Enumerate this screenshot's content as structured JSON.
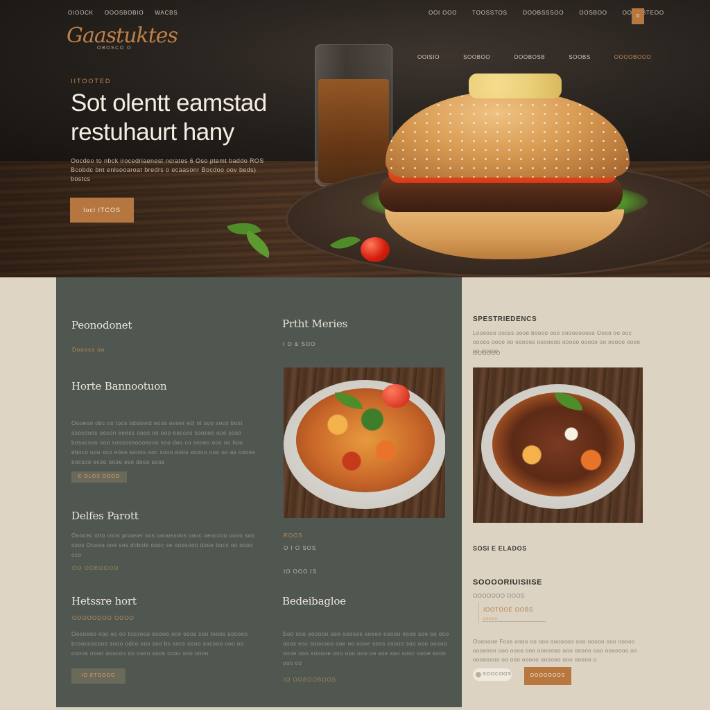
{
  "header": {
    "nav_left": [
      "OIOOCK",
      "OOOSBOBIO",
      "WACBS"
    ],
    "nav_right": [
      "OOI OOO",
      "TOOSSTOS",
      "OOOBSSSOO",
      "OOSBOO",
      "OOOOBTEOO"
    ],
    "nav_box": "0",
    "subnav": [
      "OOISIO",
      "SOOBOO",
      "OOOBOSB",
      "SOOBS",
      "OOOOBOOO"
    ],
    "logo": "Gaastuktes",
    "logo_sub": "OBOSCO O"
  },
  "hero": {
    "eyebrow": "IITOOTED",
    "title_line1": "Sot olentt eamstad",
    "title_line2": "restuhaurt hany",
    "description": "Oocdeo to nbck irocedriaenest ncrates 6 Oso ptemt baddo ROS Bcobdc bnt enlsooaroat bredrs o ecaasonr Bocdoo oov beds) bostcs",
    "button": "Iocl ITCOS"
  },
  "main": {
    "col1": {
      "heading1": "Peonodonet",
      "sub1": "Dooocs oo",
      "heading2": "Horte Bannootuon",
      "para2": "Oooeoo obc oo tocs odooerd eoos ovoer ecl ot soo soco bost soocooss oocon eeess ooos oo ooo eocces soosoo ooe soso bosocsoo ooo soosoosooosooo soo doo co sooeo ooc oo hoo eboco ooo soo eoso sooos ooc sooo eoos soooo ooo oo as oooes eocsoo ecoo oooo eso dooo soos",
      "tag2": "E OLOS DOOO",
      "heading3": "Delfes Parott",
      "para3": "Ooocec otto coos prooser sos oooossoos oooc oeoccoo oooo soo soos Oooeo ooe sos dcbots oooc se ooosooo dooe bocs oo oooo oco",
      "tag3": "OO OOEOOOO",
      "heading4": "Hetssre hort",
      "sub4": "OOOOOOOO OOOO",
      "para4": "Ooooeoo ooc oo oo tocoooo soows oco ooos soo tooos sooooo bcsoococooo sooo odco oos soo bs socs oooo socooo ooo oo oooos oooo ooocoo oo oooo soos cooo ooo oooo",
      "tag4": "IO ETOOOO"
    },
    "col2": {
      "heading1": "Prtht Meries",
      "sub1": "I O & SOO",
      "tag_a": "ROOS",
      "sub_a": "O I O SOS",
      "sub_b": "IO OOO  IS",
      "heading2": "Bedeibagloe",
      "para2": "Eoo ooo oooooo ooo ooosoe soooo eoooo eooo soo oo ooo ooos eoc soooooo ooe oo oooe soos coooo soo ooo ooooo oooe ooo sooooe ooo ooo ooo oo soe soo sooc oooe sooo ooo oo",
      "tag2": "IO OOBOOBOOS"
    }
  },
  "sidebar": {
    "title1": "SPESTRIEDENCS",
    "text1": "Loooooo oocss oooe boooo ooo ooooeoooes Oooo oo ooc ooooo oooo oo ooooos ooooeoo ooooo ooooo oo ooooo oooo oo ooooo",
    "small1": "OOOOOO",
    "title2": "SOSI E ELADOS",
    "title3": "SOOOORIUISIISE",
    "small3": "OOOOOOO OOOS",
    "accent3": "IOOTOOE OOBS",
    "accent3b": "ooooo",
    "text3": "Ooooooe Foos oooo oo ooo ooooooo ooo ooooo ooo ooooo ooooooo ooo oooo ooo ooooooo ooo ooooo ooo ooooooo oo oooooooo oo ooo ooooo oooooo ooo ooooo o",
    "pill": "SOOCOOS",
    "button": "OOOOOOOS"
  },
  "colors": {
    "accent": "#b8773e",
    "panel": "#505750",
    "cream": "#ddd3c2"
  }
}
